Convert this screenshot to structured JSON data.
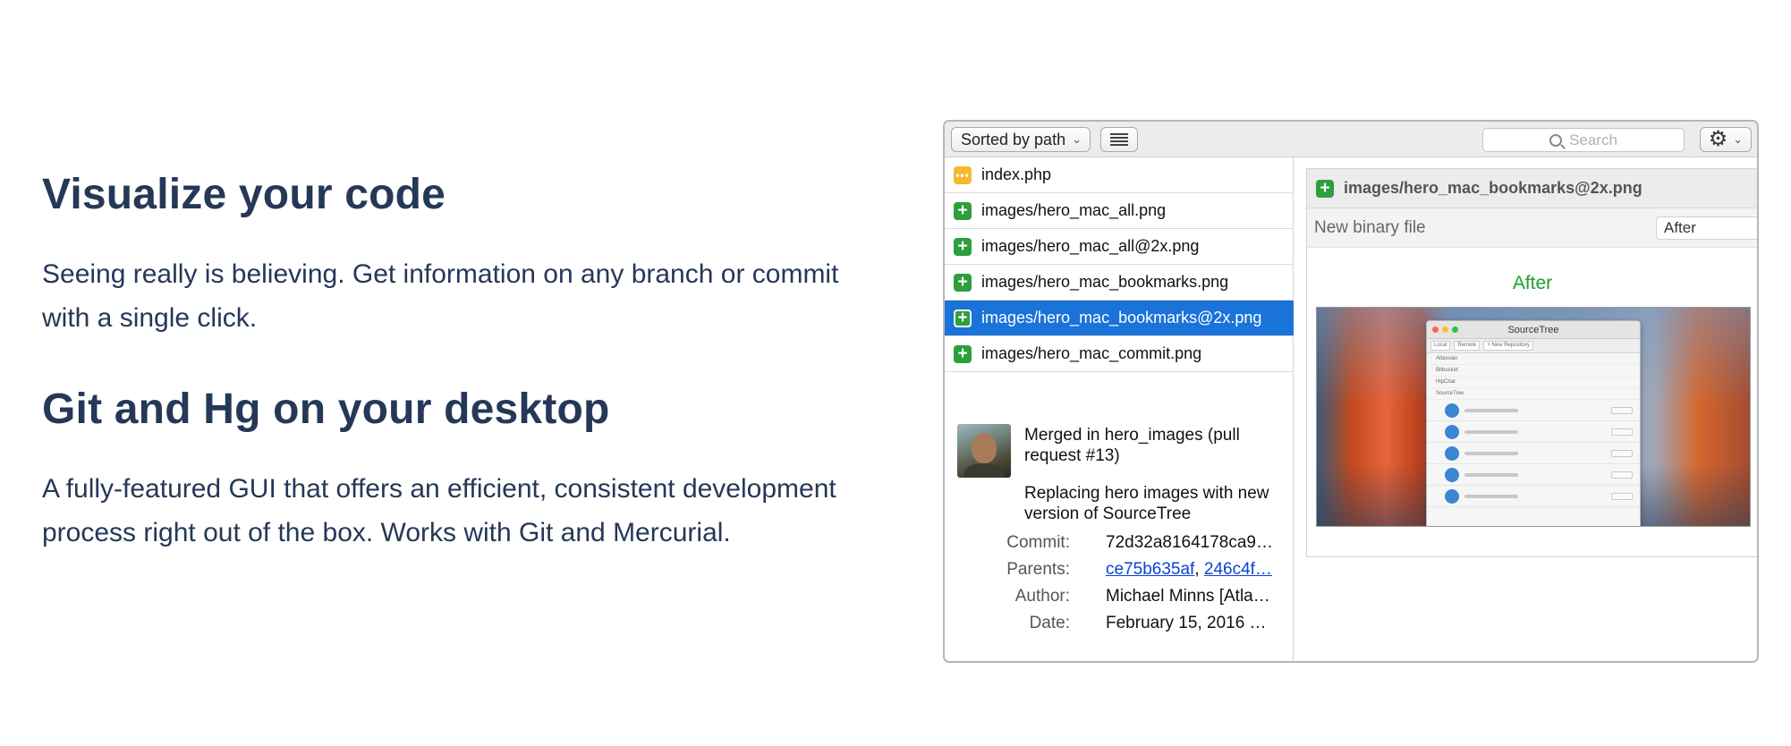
{
  "features": [
    {
      "title": "Visualize your code",
      "body": "Seeing really is believing. Get information on any branch or commit with a single click."
    },
    {
      "title": "Git and Hg on your desktop",
      "body": "A fully-featured GUI that offers an efficient, consistent development process right out of the box. Works with Git and Mercurial."
    }
  ],
  "toolbar": {
    "sort_label": "Sorted by path",
    "search_placeholder": "Search",
    "icons": {
      "sort_chevron": "chevron-down-icon",
      "list_view": "list-view-icon",
      "search": "search-icon",
      "gear": "gear-icon"
    }
  },
  "files": [
    {
      "name": "index.php",
      "status": "modified",
      "selected": false
    },
    {
      "name": "images/hero_mac_all.png",
      "status": "added",
      "selected": false
    },
    {
      "name": "images/hero_mac_all@2x.png",
      "status": "added",
      "selected": false
    },
    {
      "name": "images/hero_mac_bookmarks.png",
      "status": "added",
      "selected": false
    },
    {
      "name": "images/hero_mac_bookmarks@2x.png",
      "status": "added",
      "selected": true
    },
    {
      "name": "images/hero_mac_commit.png",
      "status": "added",
      "selected": false
    }
  ],
  "commit": {
    "summary": "Merged in hero_images (pull request #13)",
    "description": "Replacing hero images with new version of SourceTree",
    "fields": {
      "commit_label": "Commit:",
      "commit_value": "72d32a8164178ca9…",
      "parents_label": "Parents:",
      "parent_1": "ce75b635af",
      "parent_sep": ",",
      "parent_2": "246c4f…",
      "author_label": "Author:",
      "author_value": "Michael Minns [Atla…",
      "date_label": "Date:",
      "date_value": "February 15, 2016 …"
    }
  },
  "diff": {
    "file": "images/hero_mac_bookmarks@2x.png",
    "kind_label": "New binary file",
    "view_select": "After",
    "view_title": "After",
    "preview_window": {
      "title": "SourceTree",
      "tabs": [
        "Local",
        "Remote",
        "+ New Repository"
      ],
      "groups": [
        "Atlassian",
        "Bitbucket",
        "HipChat",
        "SourceTree"
      ]
    }
  },
  "colors": {
    "heading": "#253858",
    "selection": "#1a73d9",
    "added_badge": "#2e9e3e",
    "modified_badge": "#f5b82e",
    "after_green": "#18a32b",
    "link": "#0b43d6"
  }
}
